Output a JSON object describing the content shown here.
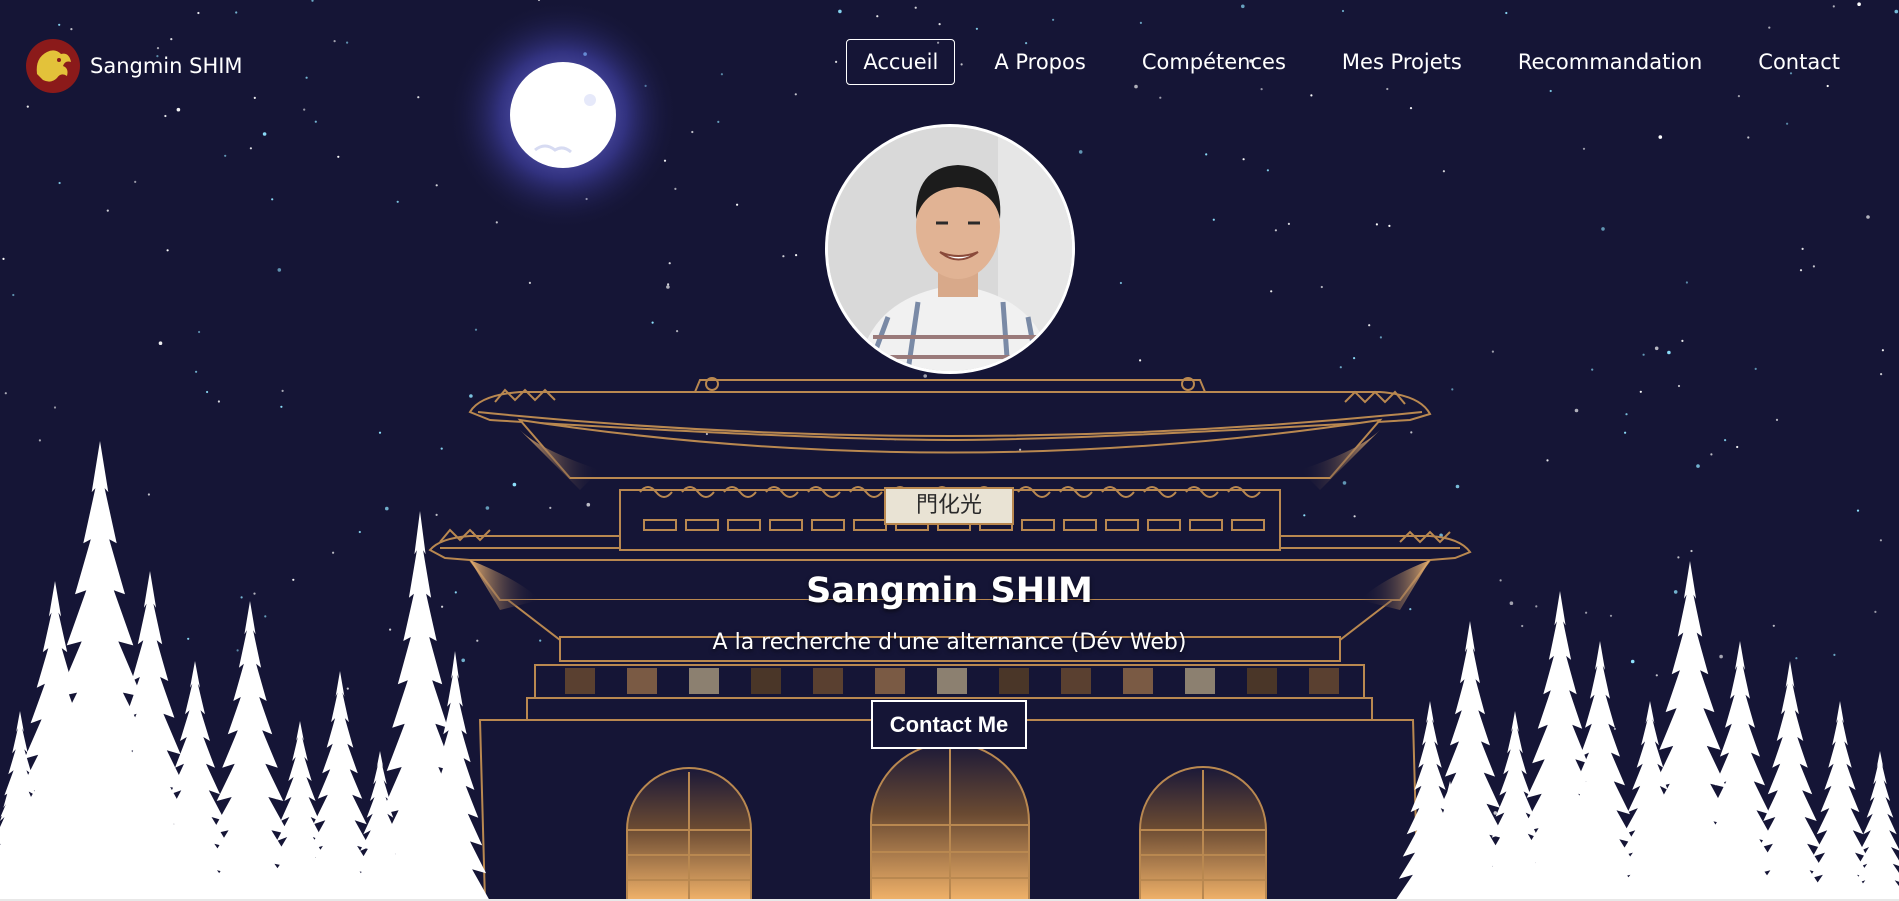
{
  "header": {
    "logo_icon": "dragon-logo-icon",
    "brand_name": "Sangmin SHIM"
  },
  "nav": {
    "items": [
      {
        "label": "Accueil",
        "active": true
      },
      {
        "label": "A Propos",
        "active": false
      },
      {
        "label": "Compétences",
        "active": false
      },
      {
        "label": "Mes Projets",
        "active": false
      },
      {
        "label": "Recommandation",
        "active": false
      },
      {
        "label": "Contact",
        "active": false
      }
    ]
  },
  "hero": {
    "title": "Sangmin SHIM",
    "subtitle": "A la recherche d'une alternance (Dév Web)",
    "cta_label": "Contact Me",
    "signboard_text": "門化光"
  },
  "theme": {
    "sky": "#151536",
    "gate_outline": "#b98850",
    "gate_glow": "#e8b070",
    "trees": "#ffffff",
    "moon": "#ffffff",
    "moon_glow": "#6a6ae8",
    "logo_bg": "#8b1a1a",
    "logo_fg": "#e3c23a"
  }
}
